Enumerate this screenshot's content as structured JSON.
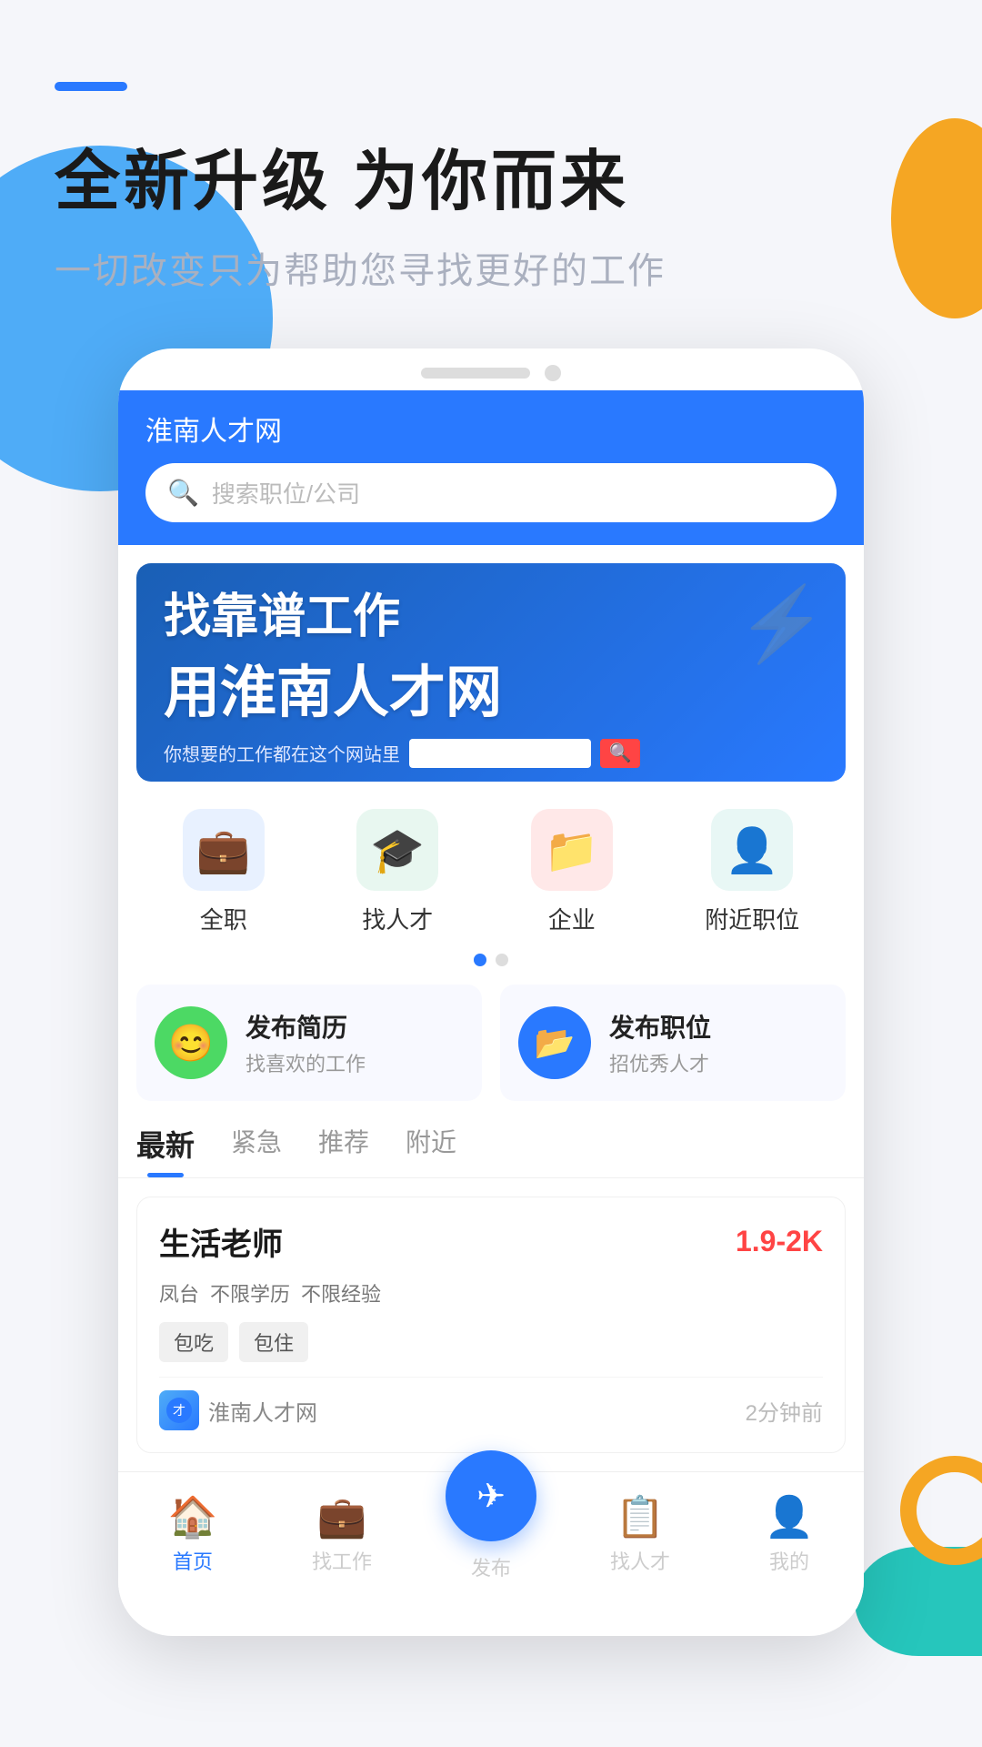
{
  "background": {
    "colors": {
      "blue": "#4facf7",
      "orange": "#f5a623",
      "teal": "#26c6bc"
    }
  },
  "header": {
    "dash_color": "#2979ff",
    "title": "全新升级 为你而来",
    "subtitle": "一切改变只为帮助您寻找更好的工作"
  },
  "phone": {
    "app_title": "淮南人才网",
    "search_placeholder": "搜索职位/公司"
  },
  "banner": {
    "line1": "找靠谱工作",
    "line2": "用淮南人才网",
    "subtext": "你想要的工作都在这个网站里"
  },
  "categories": [
    {
      "label": "全职",
      "icon": "💼",
      "color_class": "cat-icon-blue"
    },
    {
      "label": "找人才",
      "icon": "🎓",
      "color_class": "cat-icon-green"
    },
    {
      "label": "企业",
      "icon": "📁",
      "color_class": "cat-icon-red"
    },
    {
      "label": "附近职位",
      "icon": "👤",
      "color_class": "cat-icon-teal"
    }
  ],
  "actions": [
    {
      "title": "发布简历",
      "subtitle": "找喜欢的工作",
      "avatar_color": "action-avatar-green",
      "emoji": "😊"
    },
    {
      "title": "发布职位",
      "subtitle": "招优秀人才",
      "avatar_color": "action-avatar-blue",
      "emoji": "📂"
    }
  ],
  "tabs": [
    {
      "label": "最新",
      "active": true
    },
    {
      "label": "紧急",
      "active": false
    },
    {
      "label": "推荐",
      "active": false
    },
    {
      "label": "附近",
      "active": false
    }
  ],
  "job": {
    "title": "生活老师",
    "salary": "1.9-2K",
    "tags": [
      "凤台",
      "不限学历",
      "不限经验"
    ],
    "badges": [
      "包吃",
      "包住"
    ],
    "company": "淮南人才网",
    "time": "2分钟前"
  },
  "bottom_nav": [
    {
      "label": "首页",
      "icon": "🏠",
      "active": true
    },
    {
      "label": "找工作",
      "icon": "💼",
      "active": false
    },
    {
      "label": "发布",
      "icon": "✈",
      "active": false,
      "is_publish": true
    },
    {
      "label": "找人才",
      "icon": "📋",
      "active": false
    },
    {
      "label": "我的",
      "icon": "👤",
      "active": false
    }
  ]
}
